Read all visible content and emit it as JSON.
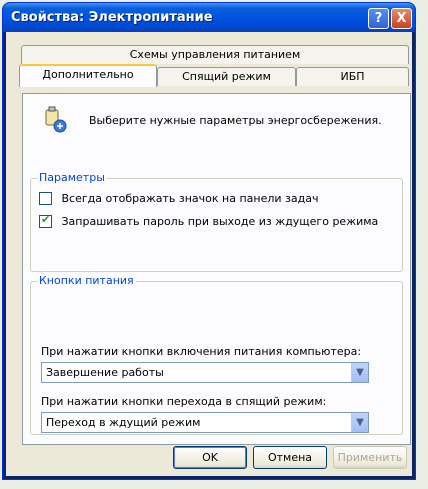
{
  "window": {
    "title": "Свойства: Электропитание",
    "help_label": "?",
    "close_label": "X"
  },
  "tabs": {
    "row_top": "Схемы управления питанием",
    "row_bottom": [
      {
        "label": "Дополнительно",
        "active": true
      },
      {
        "label": "Спящий режим",
        "active": false
      },
      {
        "label": "ИБП",
        "active": false
      }
    ]
  },
  "panel": {
    "info_text": "Выберите нужные параметры энергосбережения.",
    "params_group": {
      "title": "Параметры",
      "options": [
        {
          "label": "Всегда отображать значок на панели задач",
          "checked": false
        },
        {
          "label": "Запрашивать пароль при выходе из ждущего режима",
          "checked": true
        }
      ]
    },
    "power_buttons_group": {
      "title": "Кнопки питания",
      "power_button_label": "При нажатии кнопки включения питания компьютера:",
      "power_button_value": "Завершение работы",
      "sleep_button_label": "При нажатии кнопки перехода в спящий режим:",
      "sleep_button_value": "Переход в ждущий режим"
    }
  },
  "buttons": {
    "ok": "OK",
    "cancel": "Отмена",
    "apply": "Применить"
  },
  "check_glyph": "✔",
  "dropdown_glyph": "▼",
  "colors": {
    "titlebar": "#0054e3",
    "close_button": "#c9411e",
    "group_label": "#0046d5",
    "tab_highlight": "#ffc83c"
  }
}
